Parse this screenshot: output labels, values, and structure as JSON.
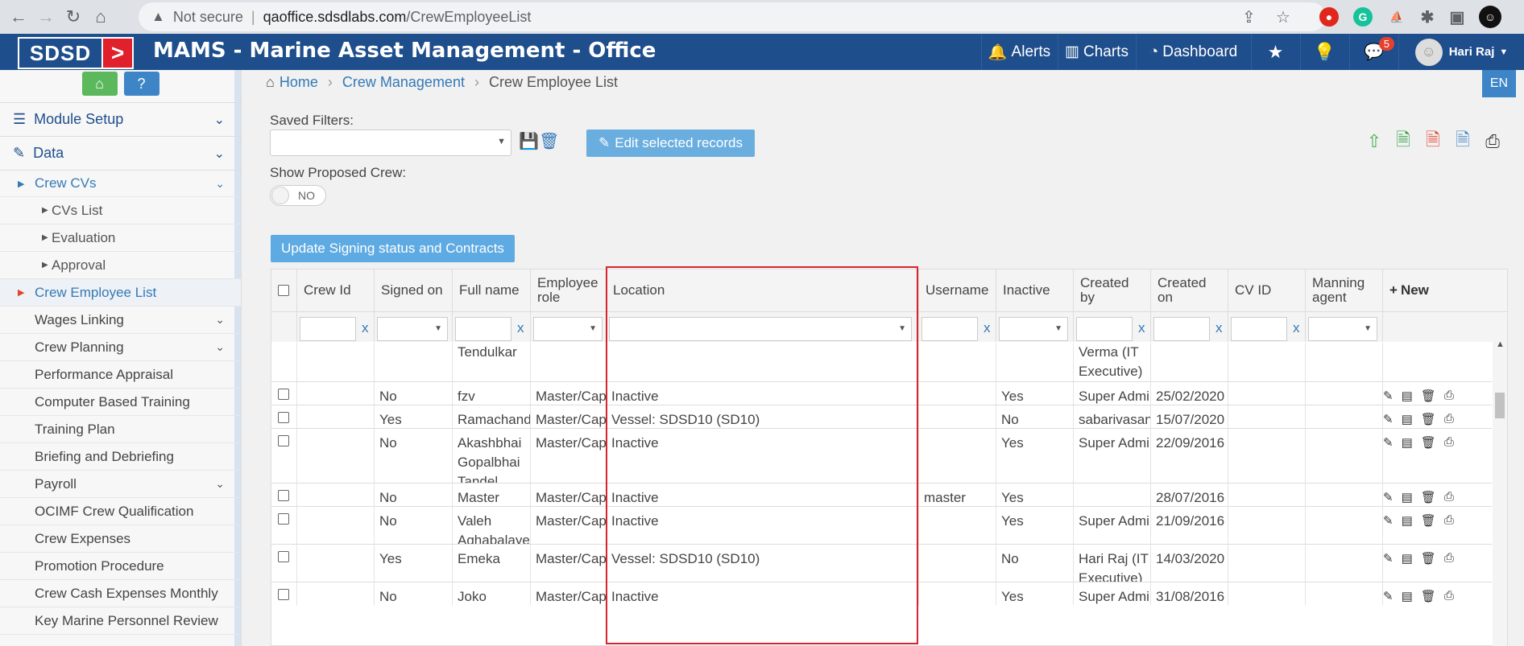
{
  "browser": {
    "security": "Not secure",
    "url_host": "qaoffice.sdsdlabs.com",
    "url_path": "/CrewEmployeeList",
    "nav_icons": [
      "back-icon",
      "forward-icon",
      "reload-icon",
      "home-icon"
    ]
  },
  "app": {
    "logo_text": "SDSD",
    "title": "MAMS - Marine Asset Management - Office",
    "nav": {
      "alerts": "Alerts",
      "charts": "Charts",
      "dashboard": "Dashboard",
      "messages_badge": "5",
      "user": "Hari Raj"
    },
    "lang": "EN"
  },
  "sidebar": {
    "sections": [
      {
        "label": "Module Setup"
      },
      {
        "label": "Data"
      }
    ],
    "crew_cvs": "Crew CVs",
    "crew_cvs_sub": [
      "CVs List",
      "Evaluation",
      "Approval"
    ],
    "items": [
      {
        "label": "Crew Employee List",
        "active": true,
        "chev": false
      },
      {
        "label": "Wages Linking",
        "chev": true
      },
      {
        "label": "Crew Planning",
        "chev": true
      },
      {
        "label": "Performance Appraisal",
        "chev": false
      },
      {
        "label": "Computer Based Training",
        "chev": false
      },
      {
        "label": "Training Plan",
        "chev": false
      },
      {
        "label": "Briefing and Debriefing",
        "chev": false
      },
      {
        "label": "Payroll",
        "chev": true
      },
      {
        "label": "OCIMF Crew Qualification",
        "chev": false
      },
      {
        "label": "Crew Expenses",
        "chev": false
      },
      {
        "label": "Promotion Procedure",
        "chev": false
      },
      {
        "label": "Crew Cash Expenses Monthly",
        "chev": false
      },
      {
        "label": "Key Marine Personnel Review",
        "chev": false
      }
    ]
  },
  "breadcrumb": {
    "home": "Home",
    "level1": "Crew Management",
    "current": "Crew Employee List"
  },
  "filters": {
    "saved_label": "Saved Filters:",
    "edit_button": "Edit selected records",
    "proposed_label": "Show Proposed Crew:",
    "toggle_value": "NO",
    "update_button": "Update Signing status and Contracts"
  },
  "grid": {
    "headers": {
      "crew_id": "Crew Id",
      "signed_on": "Signed on",
      "full_name": "Full name",
      "employee_role_1": "Employee",
      "employee_role_2": "role",
      "location": "Location",
      "username": "Username",
      "inactive": "Inactive",
      "created_by_1": "Created",
      "created_by_2": "by",
      "created_on_1": "Created",
      "created_on_2": "on",
      "cv_id": "CV ID",
      "manning_agent_1": "Manning",
      "manning_agent_2": "agent",
      "new": "New"
    },
    "filter_clear": "x",
    "partial_row": {
      "full_name": "Tendulkar",
      "created_by": [
        "Verma (IT",
        "Executive)"
      ]
    },
    "rows": [
      {
        "signed_on": "No",
        "full_name": [
          "fzv"
        ],
        "role": "Master/Cap",
        "location": "Inactive",
        "username": "",
        "inactive": "Yes",
        "created_by": [
          "Super Admi"
        ],
        "created_on": "25/02/2020"
      },
      {
        "signed_on": "Yes",
        "full_name": [
          "Ramachand"
        ],
        "role": "Master/Cap",
        "location": "Vessel: SDSD10 (SD10)",
        "username": "",
        "inactive": "No",
        "created_by": [
          "sabarivasan"
        ],
        "created_on": "15/07/2020"
      },
      {
        "signed_on": "No",
        "full_name": [
          "Akashbhai",
          "Gopalbhai",
          "Tandel"
        ],
        "role": "Master/Cap",
        "location": "Inactive",
        "username": "",
        "inactive": "Yes",
        "created_by": [
          "Super Admi"
        ],
        "created_on": "22/09/2016"
      },
      {
        "signed_on": "No",
        "full_name": [
          "Master"
        ],
        "role": "Master/Cap",
        "location": "Inactive",
        "username": "master",
        "inactive": "Yes",
        "created_by": [
          ""
        ],
        "created_on": "28/07/2016"
      },
      {
        "signed_on": "No",
        "full_name": [
          "Valeh",
          "Aghabalayev"
        ],
        "role": "Master/Cap",
        "location": "Inactive",
        "username": "",
        "inactive": "Yes",
        "created_by": [
          "Super Admi"
        ],
        "created_on": "21/09/2016"
      },
      {
        "signed_on": "Yes",
        "full_name": [
          "Emeka"
        ],
        "role": "Master/Cap",
        "location": "Vessel: SDSD10 (SD10)",
        "username": "",
        "inactive": "No",
        "created_by": [
          "Hari Raj (IT",
          "Executive)"
        ],
        "created_on": "14/03/2020"
      },
      {
        "signed_on": "No",
        "full_name": [
          "Joko"
        ],
        "role": "Master/Cap",
        "location": "Inactive",
        "username": "",
        "inactive": "Yes",
        "created_by": [
          "Super Admi"
        ],
        "created_on": "31/08/2016"
      }
    ]
  },
  "colors": {
    "header_blue": "#1f4e8c",
    "link": "#337ab7",
    "highlight": "#d9232e"
  }
}
